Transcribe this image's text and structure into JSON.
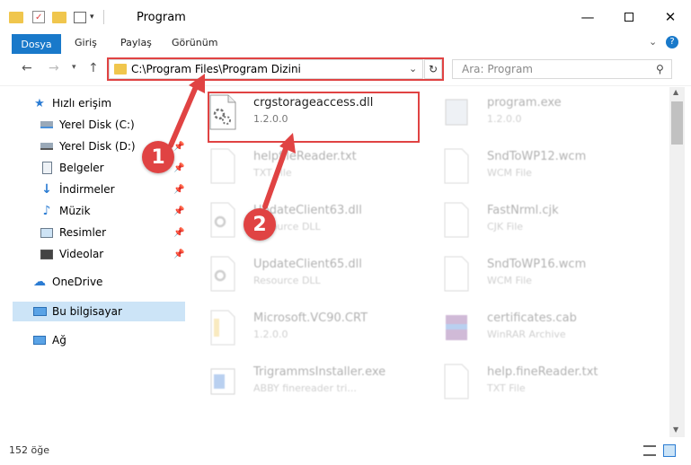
{
  "window": {
    "title": "Program",
    "min_icon": "minimize-icon",
    "max_icon": "maximize-icon",
    "close_icon": "close-icon"
  },
  "ribbon": {
    "tabs": [
      "Dosya",
      "Giriş",
      "Paylaş",
      "Görünüm"
    ],
    "accent": "#1979ca"
  },
  "nav": {
    "address": "C:\\Program Files\\Program Dizini",
    "search_placeholder": "Ara: Program"
  },
  "sidebar": {
    "items": [
      {
        "label": "Hızlı erişim",
        "icon": "star-icon"
      },
      {
        "label": "Yerel Disk (C:)",
        "icon": "drive-icon"
      },
      {
        "label": "Yerel Disk (D:)",
        "icon": "drive-icon"
      },
      {
        "label": "Belgeler",
        "icon": "documents-icon"
      },
      {
        "label": "İndirmeler",
        "icon": "download-icon"
      },
      {
        "label": "Müzik",
        "icon": "music-icon"
      },
      {
        "label": "Resimler",
        "icon": "pictures-icon"
      },
      {
        "label": "Videolar",
        "icon": "videos-icon"
      },
      {
        "label": "OneDrive",
        "icon": "cloud-icon"
      },
      {
        "label": "Bu bilgisayar",
        "icon": "computer-icon"
      },
      {
        "label": "Ağ",
        "icon": "network-icon"
      }
    ]
  },
  "files": [
    {
      "name": "crgstorageaccess.dll",
      "sub": "1.2.0.0"
    },
    {
      "name": "program.exe",
      "sub": "1.2.0.0"
    },
    {
      "name": "helpfileReader.txt",
      "sub": "TXT File"
    },
    {
      "name": "SndToWP12.wcm",
      "sub": "WCM File"
    },
    {
      "name": "UpdateClient63.dll",
      "sub": "Resource DLL"
    },
    {
      "name": "FastNrml.cjk",
      "sub": "CJK File"
    },
    {
      "name": "UpdateClient65.dll",
      "sub": "Resource DLL"
    },
    {
      "name": "SndToWP16.wcm",
      "sub": "WCM File"
    },
    {
      "name": "Microsoft.VC90.CRT",
      "sub": "1.2.0.0"
    },
    {
      "name": "certificates.cab",
      "sub": "WinRAR Archive"
    },
    {
      "name": "TrigrammsInstaller.exe",
      "sub": "ABBY finereader tri..."
    },
    {
      "name": "help.fineReader.txt",
      "sub": "TXT File"
    }
  ],
  "status": {
    "count": "152 öğe"
  },
  "annotations": {
    "step1": "1",
    "step2": "2",
    "color": "#e04343"
  }
}
